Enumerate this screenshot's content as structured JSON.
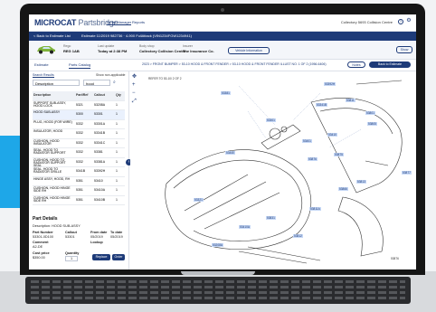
{
  "app": {
    "brand": "MICROCAT",
    "brand_suffix": "Partsbridge"
  },
  "nav": [
    "Order Manager",
    "Reports"
  ],
  "header_right": {
    "account": "Collectory 5693 Collision Centre"
  },
  "crumb": {
    "back": "< Back to Estimate List",
    "estimate": "Estimate 11/2019 982736 · 4-900 FullAttack (VIN1234FGW1234941)"
  },
  "vehicle": [
    {
      "label": "Rego",
      "value": "REG 1AB"
    },
    {
      "label": "Last update",
      "value": "Today at 2:38 PM"
    },
    {
      "label": "Body shop",
      "value": "Collectory Collision Centre"
    },
    {
      "label": "Insurer",
      "value": "The Insurance Co."
    }
  ],
  "vehicle_info_button": "Vehicle Information",
  "show_button": "Show",
  "tabs": {
    "estimate": "Estimate",
    "catalog": "Parts Catalog"
  },
  "diagram_breadcrumb": "2023 > FRONT BUMPER > 53-10 HOOD & FRONT FENDER > 53-10 HOOD & FRONT FENDER ILLUST NO. 1 OF 2 (1956-6406)",
  "top_buttons": {
    "notes": "Notes",
    "back": "Back to Estimate"
  },
  "search": {
    "tab_label": "Search Results",
    "field": "Description",
    "value": "hood",
    "show_non_applicable": "Show non-applicable"
  },
  "table": {
    "headers": [
      "Description",
      "Part/Ref",
      "Callout",
      "Qty"
    ],
    "rows": [
      [
        "SUPPORT SUB-ASSY, HOOD LOCK",
        "5321",
        "53208A",
        "1"
      ],
      [
        "HOOD SUB-ASSY",
        "5300",
        "53301",
        "1"
      ],
      [
        "PLUG, HOOD (FOR WIRE)",
        "5332",
        "53301A",
        "1"
      ],
      [
        "INSULATOR, HOOD",
        "5332",
        "53341B",
        "1"
      ],
      [
        "CUSHION, HOOD INSULATOR",
        "5332",
        "53341C",
        "1"
      ],
      [
        "SEAL, HOOD TO RADIATOR SUPPORT",
        "5332",
        "53381",
        "1"
      ],
      [
        "CUSHION, HOOD TO RADIATOR SUPPORT SEAL",
        "5332",
        "53381A",
        "1"
      ],
      [
        "SEAL, HOOD TO RADIATOR GRILLE",
        "5341B",
        "53392H",
        "1"
      ],
      [
        "HINGE ASSY, HOOD, RH",
        "5351",
        "53410",
        "1"
      ],
      [
        "CUSHION, HOOD HINGE SIDE RH",
        "5351",
        "53410A",
        "1"
      ],
      [
        "CUSHION, HOOD HINGE SIDE RH",
        "5351",
        "53410B",
        "1"
      ]
    ]
  },
  "part_details": {
    "title": "Part Details",
    "description": "Description: HOOD SUB-ASSY",
    "part_number_label": "Part Number",
    "part_number": "53301-0D100",
    "callout_label": "Callout",
    "callout": "53301",
    "from_date_label": "From date",
    "from_date": "05/2019",
    "to_date_label": "To date",
    "to_date": "05/2019",
    "comment_label": "Comment",
    "comment": "A2-DE",
    "lookup_label": "Lookup",
    "cost_label": "Cost price",
    "cost": "$350.00",
    "qty_label": "Quantity",
    "qty": "1",
    "replace": "Replace",
    "order": "Order"
  },
  "diagram": {
    "callouts": [
      "53301",
      "53341B",
      "53381",
      "53392H",
      "53410",
      "53440",
      "53401",
      "53801",
      "53805",
      "53811",
      "53875",
      "53876",
      "53877",
      "53866",
      "53811A",
      "53812",
      "53813",
      "53831",
      "53410A",
      "53321",
      "53208A"
    ],
    "note": "REFER TO 53-10/ 2 OF 2",
    "fig": "53876"
  },
  "colors": {
    "navy": "#1d3a78",
    "accent": "#1ea7e8",
    "callout_bg": "#c6d8f6"
  }
}
